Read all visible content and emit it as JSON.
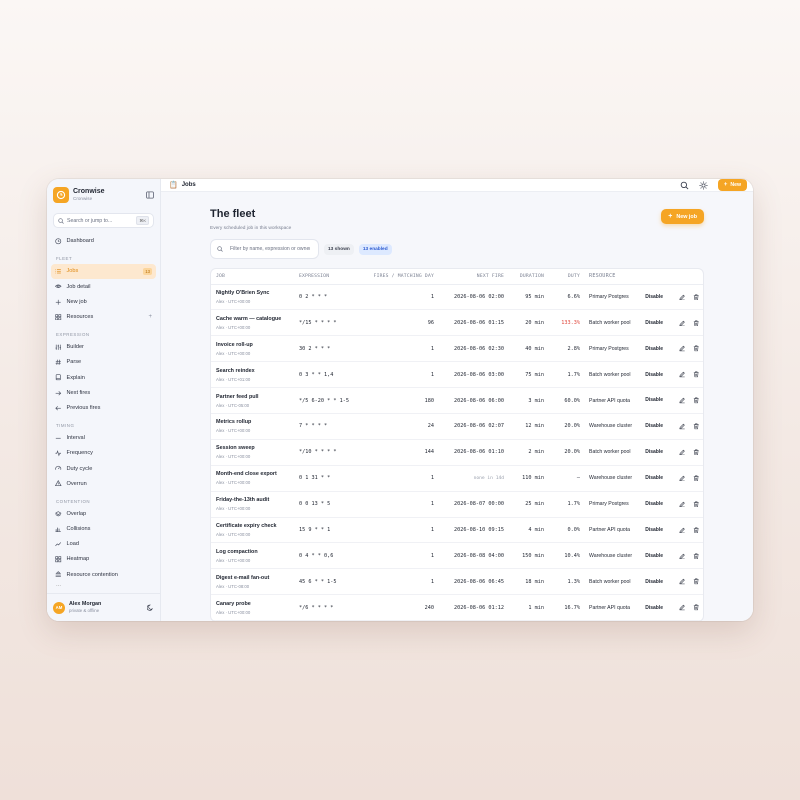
{
  "app": {
    "name": "Cronwise",
    "workspace": "Cronwise"
  },
  "sidebar": {
    "search": {
      "placeholder": "Search or jump to...",
      "shortcut": "⌘K"
    },
    "top_items": [
      {
        "label": "Dashboard",
        "icon": "clock-icon"
      }
    ],
    "sections": [
      {
        "title": "FLEET",
        "items": [
          {
            "label": "Jobs",
            "icon": "list-icon",
            "badge": "13",
            "active": true
          },
          {
            "label": "Job detail",
            "icon": "eye-icon"
          },
          {
            "label": "New job",
            "icon": "plus-icon"
          },
          {
            "label": "Resources",
            "icon": "grid-icon",
            "trailing": "+"
          }
        ]
      },
      {
        "title": "EXPRESSION",
        "items": [
          {
            "label": "Builder",
            "icon": "sliders-icon"
          },
          {
            "label": "Parse",
            "icon": "hash-icon"
          },
          {
            "label": "Explain",
            "icon": "book-icon"
          },
          {
            "label": "Next fires",
            "icon": "arrow-right-icon"
          },
          {
            "label": "Previous fires",
            "icon": "arrow-left-icon"
          }
        ]
      },
      {
        "title": "TIMING",
        "items": [
          {
            "label": "Interval",
            "icon": "minus-icon"
          },
          {
            "label": "Frequency",
            "icon": "pulse-icon"
          },
          {
            "label": "Duty cycle",
            "icon": "gauge-icon"
          },
          {
            "label": "Overrun",
            "icon": "alert-icon"
          }
        ]
      },
      {
        "title": "CONTENTION",
        "items": [
          {
            "label": "Overlap",
            "icon": "layers-icon"
          },
          {
            "label": "Collisions",
            "icon": "bar-chart-icon"
          },
          {
            "label": "Load",
            "icon": "trend-icon"
          },
          {
            "label": "Heatmap",
            "icon": "grid-icon"
          },
          {
            "label": "Resource contention",
            "icon": "stack-icon"
          }
        ]
      }
    ],
    "more": "...",
    "user": {
      "initials": "AM",
      "name": "Alex Morgan",
      "status": "private & offline"
    }
  },
  "topbar": {
    "crumb": "Jobs",
    "new_label": "New"
  },
  "page": {
    "title": "The fleet",
    "subtitle": "Every scheduled job in this workspace",
    "new_job_label": "New job",
    "filter_placeholder": "Filter by name, expression or owner",
    "shown_pill": "13 shown",
    "enabled_pill": "13 enabled"
  },
  "table": {
    "columns": [
      "JOB",
      "EXPRESSION",
      "FIRES / MATCHING DAY",
      "NEXT FIRE",
      "DURATION",
      "DUTY",
      "RESOURCE"
    ],
    "disable_label": "Disable",
    "rows": [
      {
        "name": "Nightly O'Brien Sync",
        "meta": "Alex · UTC+00:00",
        "expr": "0 2 * * *",
        "fires": "1",
        "next": "2026-08-06 02:00",
        "next_muted": false,
        "duration": "95 min",
        "duty": "6.6%",
        "duty_warn": false,
        "resource": "Primary Postgres"
      },
      {
        "name": "Cache warm — catalogue",
        "meta": "Alex · UTC+00:00",
        "expr": "*/15 * * * *",
        "fires": "96",
        "next": "2026-08-06 01:15",
        "next_muted": false,
        "duration": "20 min",
        "duty": "133.3%",
        "duty_warn": true,
        "resource": "Batch worker pool"
      },
      {
        "name": "Invoice roll-up",
        "meta": "Alex · UTC+00:00",
        "expr": "30 2 * * *",
        "fires": "1",
        "next": "2026-08-06 02:30",
        "next_muted": false,
        "duration": "40 min",
        "duty": "2.8%",
        "duty_warn": false,
        "resource": "Primary Postgres"
      },
      {
        "name": "Search reindex",
        "meta": "Alex · UTC+01:00",
        "expr": "0 3 * * 1,4",
        "fires": "1",
        "next": "2026-08-06 03:00",
        "next_muted": false,
        "duration": "75 min",
        "duty": "1.7%",
        "duty_warn": false,
        "resource": "Batch worker pool"
      },
      {
        "name": "Partner feed pull",
        "meta": "Alex · UTC-05:00",
        "expr": "*/5 6-20 * * 1-5",
        "fires": "180",
        "next": "2026-08-06 06:00",
        "next_muted": false,
        "duration": "3 min",
        "duty": "60.0%",
        "duty_warn": false,
        "resource": "Partner API quota"
      },
      {
        "name": "Metrics rollup",
        "meta": "Alex · UTC+00:00",
        "expr": "7 * * * *",
        "fires": "24",
        "next": "2026-08-06 02:07",
        "next_muted": false,
        "duration": "12 min",
        "duty": "20.0%",
        "duty_warn": false,
        "resource": "Warehouse cluster"
      },
      {
        "name": "Session sweep",
        "meta": "Alex · UTC+00:00",
        "expr": "*/10 * * * *",
        "fires": "144",
        "next": "2026-08-06 01:10",
        "next_muted": false,
        "duration": "2 min",
        "duty": "20.0%",
        "duty_warn": false,
        "resource": "Batch worker pool"
      },
      {
        "name": "Month-end close export",
        "meta": "Alex · UTC+00:00",
        "expr": "0 1 31 * *",
        "fires": "1",
        "next": "none in 14d",
        "next_muted": true,
        "duration": "110 min",
        "duty": "–",
        "duty_warn": false,
        "resource": "Warehouse cluster"
      },
      {
        "name": "Friday-the-13th audit",
        "meta": "Alex · UTC+00:00",
        "expr": "0 0 13 * 5",
        "fires": "1",
        "next": "2026-08-07 00:00",
        "next_muted": false,
        "duration": "25 min",
        "duty": "1.7%",
        "duty_warn": false,
        "resource": "Primary Postgres"
      },
      {
        "name": "Certificate expiry check",
        "meta": "Alex · UTC+00:00",
        "expr": "15 9 * * 1",
        "fires": "1",
        "next": "2026-08-10 09:15",
        "next_muted": false,
        "duration": "4 min",
        "duty": "0.0%",
        "duty_warn": false,
        "resource": "Partner API quota"
      },
      {
        "name": "Log compaction",
        "meta": "Alex · UTC+00:00",
        "expr": "0 4 * * 0,6",
        "fires": "1",
        "next": "2026-08-08 04:00",
        "next_muted": false,
        "duration": "150 min",
        "duty": "10.4%",
        "duty_warn": false,
        "resource": "Warehouse cluster"
      },
      {
        "name": "Digest e-mail fan-out",
        "meta": "Alex · UTC-08:00",
        "expr": "45 6 * * 1-5",
        "fires": "1",
        "next": "2026-08-06 06:45",
        "next_muted": false,
        "duration": "18 min",
        "duty": "1.3%",
        "duty_warn": false,
        "resource": "Batch worker pool"
      },
      {
        "name": "Canary probe",
        "meta": "Alex · UTC+00:00",
        "expr": "*/6 * * * *",
        "fires": "240",
        "next": "2026-08-06 01:12",
        "next_muted": false,
        "duration": "1 min",
        "duty": "16.7%",
        "duty_warn": false,
        "resource": "Partner API quota"
      }
    ]
  },
  "colors": {
    "accent": "#f5a524",
    "warn": "#e0483d",
    "enabled": "#2d5bd1"
  }
}
